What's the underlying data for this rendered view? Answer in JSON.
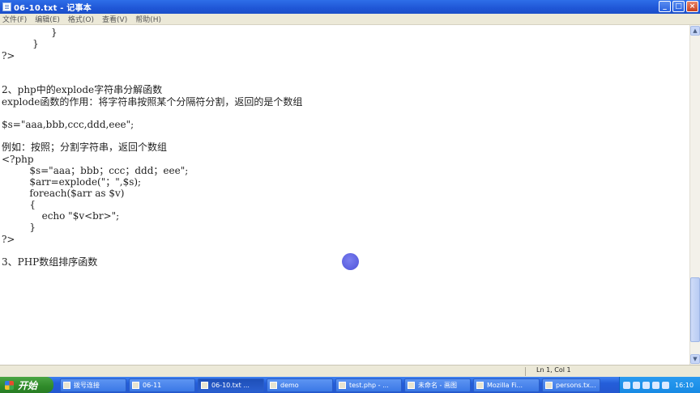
{
  "window": {
    "title": "06-10.txt - 记事本",
    "buttons": {
      "minimize": "_",
      "maximize": "□",
      "close": "×"
    }
  },
  "menu": [
    "文件(F)",
    "编辑(E)",
    "格式(O)",
    "查看(V)",
    "帮助(H)"
  ],
  "editor": {
    "lines": [
      "                }",
      "          }",
      "?>",
      "",
      "2、php中的explode字符串分解函数",
      "explode函数的作用：将字符串按照某个分隔符分割，返回的是个数组",
      "",
      "$s=\"aaa,bbb,ccc,ddd,eee\";",
      "",
      "例如：按照；分割字符串，返回个数组",
      "<?php",
      "         $s=\"aaa；bbb；ccc；ddd；eee\";",
      "         $arr=explode(\"；\",$s);",
      "         foreach($arr as $v)",
      "         {",
      "             echo \"$v<br>\";",
      "         }",
      "?>",
      "",
      "3、PHP数组排序函数"
    ]
  },
  "status": {
    "position": "Ln 1, Col 1"
  },
  "taskbar": {
    "start_label": "开始",
    "items": [
      {
        "label": "拨号连接",
        "icon": "network-icon"
      },
      {
        "label": "06-11",
        "icon": "folder-icon"
      },
      {
        "label": "06-10.txt ...",
        "icon": "notepad-icon",
        "active": true
      },
      {
        "label": "demo",
        "icon": "folder-icon"
      },
      {
        "label": "test.php - ...",
        "icon": "notepad-icon"
      },
      {
        "label": "未命名 - 画图",
        "icon": "paint-icon"
      },
      {
        "label": "Mozilla Fi...",
        "icon": "firefox-icon"
      },
      {
        "label": "persons.tx...",
        "icon": "notepad-icon"
      }
    ],
    "clock": "16:10"
  },
  "colors": {
    "titlebar": "#245ed9",
    "taskbar": "#245ed9",
    "start": "#2f8a2a",
    "cursor": "#5b60e0"
  }
}
